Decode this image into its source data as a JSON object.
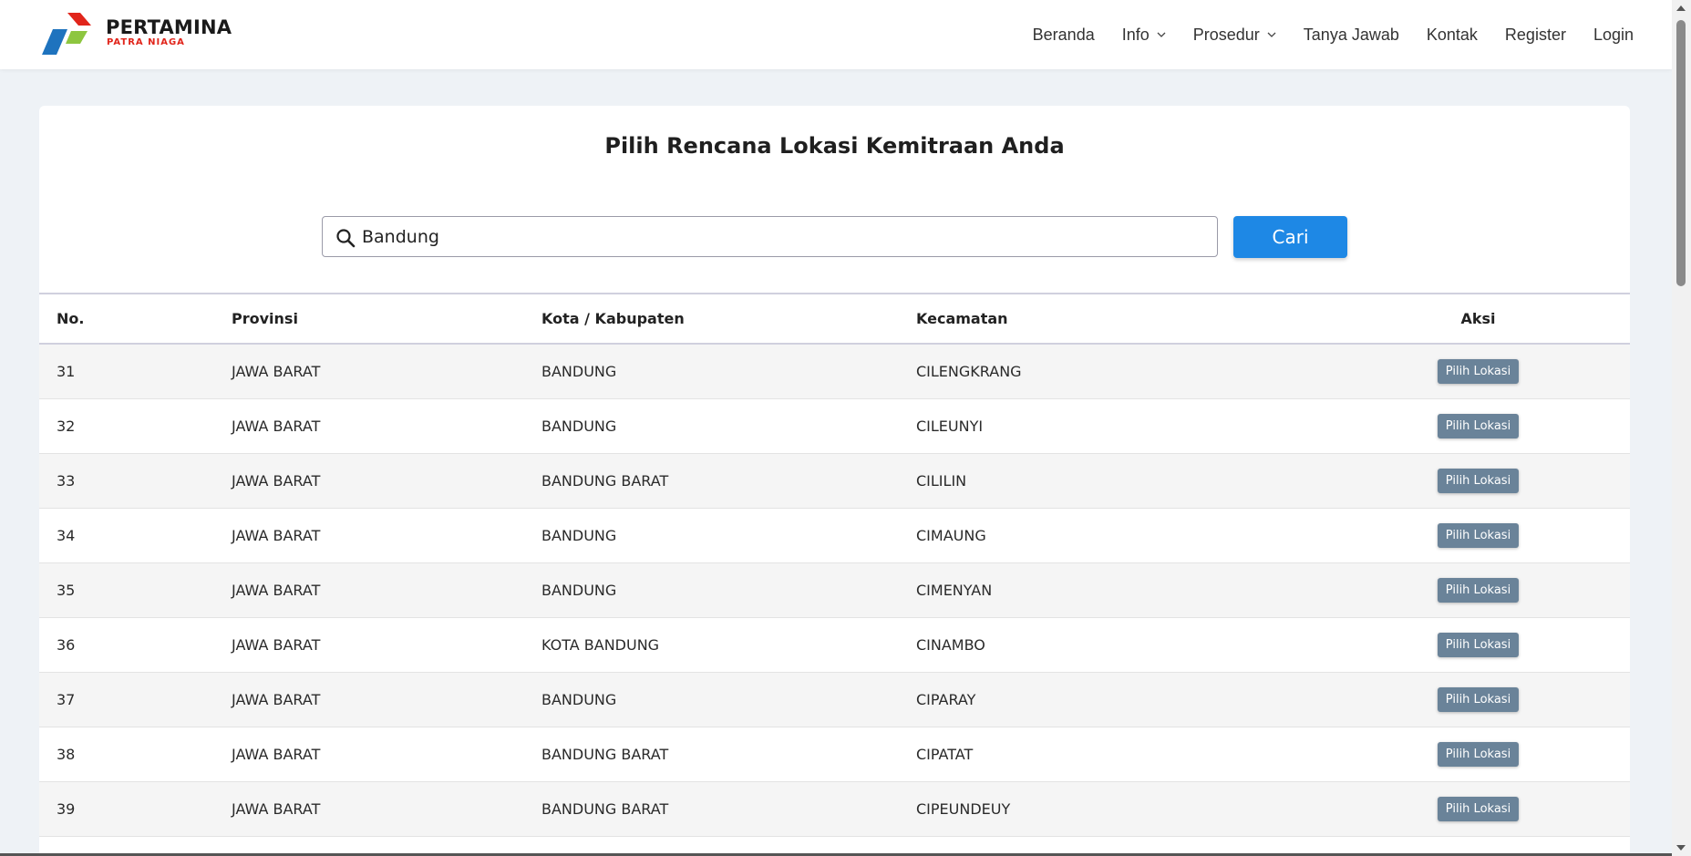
{
  "brand": {
    "name": "PERTAMINA",
    "subtitle": "PATRA NIAGA",
    "colors": {
      "red": "#e1251b",
      "blue": "#1e73be",
      "green": "#8dc63f"
    }
  },
  "nav": {
    "items": [
      {
        "label": "Beranda",
        "dropdown": false
      },
      {
        "label": "Info",
        "dropdown": true
      },
      {
        "label": "Prosedur",
        "dropdown": true
      },
      {
        "label": "Tanya Jawab",
        "dropdown": false
      },
      {
        "label": "Kontak",
        "dropdown": false
      },
      {
        "label": "Register",
        "dropdown": false
      },
      {
        "label": "Login",
        "dropdown": false
      }
    ]
  },
  "main": {
    "title": "Pilih Rencana Lokasi Kemitraan Anda",
    "search": {
      "value": "Bandung",
      "button_label": "Cari",
      "icon": "search-icon"
    }
  },
  "table": {
    "headers": [
      "No.",
      "Provinsi",
      "Kota / Kabupaten",
      "Kecamatan",
      "Aksi"
    ],
    "action_label": "Pilih Lokasi",
    "rows": [
      {
        "no": "31",
        "provinsi": "JAWA BARAT",
        "kota": "BANDUNG",
        "kecamatan": "CILENGKRANG"
      },
      {
        "no": "32",
        "provinsi": "JAWA BARAT",
        "kota": "BANDUNG",
        "kecamatan": "CILEUNYI"
      },
      {
        "no": "33",
        "provinsi": "JAWA BARAT",
        "kota": "BANDUNG BARAT",
        "kecamatan": "CILILIN"
      },
      {
        "no": "34",
        "provinsi": "JAWA BARAT",
        "kota": "BANDUNG",
        "kecamatan": "CIMAUNG"
      },
      {
        "no": "35",
        "provinsi": "JAWA BARAT",
        "kota": "BANDUNG",
        "kecamatan": "CIMENYAN"
      },
      {
        "no": "36",
        "provinsi": "JAWA BARAT",
        "kota": "KOTA BANDUNG",
        "kecamatan": "CINAMBO"
      },
      {
        "no": "37",
        "provinsi": "JAWA BARAT",
        "kota": "BANDUNG",
        "kecamatan": "CIPARAY"
      },
      {
        "no": "38",
        "provinsi": "JAWA BARAT",
        "kota": "BANDUNG BARAT",
        "kecamatan": "CIPATAT"
      },
      {
        "no": "39",
        "provinsi": "JAWA BARAT",
        "kota": "BANDUNG BARAT",
        "kecamatan": "CIPEUNDEUY"
      }
    ]
  },
  "colors": {
    "primary_button": "#1e88e5",
    "row_action_button": "#6a8399",
    "page_background": "#eef2f6"
  }
}
